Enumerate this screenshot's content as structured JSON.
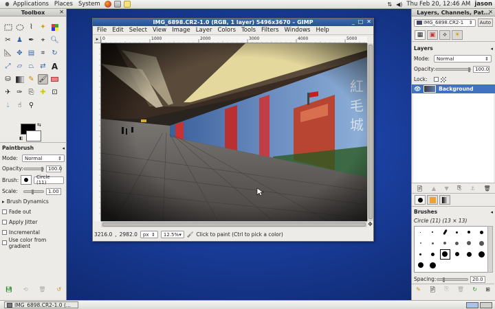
{
  "topbar": {
    "applications": "Applications",
    "places": "Places",
    "system": "System",
    "datetime": "Thu Feb 20, 12:46 AM",
    "user": "jason"
  },
  "toolbox": {
    "title": "Toolbox",
    "tool_options": {
      "title": "Paintbrush",
      "mode_label": "Mode:",
      "mode_value": "Normal",
      "opacity_label": "Opacity:",
      "opacity_value": "100.0",
      "brush_label": "Brush:",
      "brush_value": "Circle (11)",
      "scale_label": "Scale:",
      "scale_value": "1.00",
      "brush_dynamics": "Brush Dynamics",
      "fade_out": "Fade out",
      "apply_jitter": "Apply Jitter",
      "incremental": "Incremental",
      "use_color_gradient": "Use color from gradient"
    }
  },
  "image_window": {
    "title": "IMG_6898.CR2-1.0 (RGB, 1 layer) 5496x3670 – GIMP",
    "menus": [
      "File",
      "Edit",
      "Select",
      "View",
      "Image",
      "Layer",
      "Colors",
      "Tools",
      "Filters",
      "Windows",
      "Help"
    ],
    "ruler_ticks": [
      "0",
      "1000",
      "2000",
      "3000",
      "4000",
      "5000"
    ],
    "status": {
      "x": "3216.0",
      "y": "2982.0",
      "unit": "px",
      "zoom": "12.5%",
      "message": "Click to paint (Ctrl to pick a color)"
    }
  },
  "dock": {
    "title": "Layers, Channels, Pat...",
    "image_combo": "IMG_6898.CR2-1",
    "auto_button": "Auto",
    "layers_title": "Layers",
    "mode_label": "Mode:",
    "mode_value": "Normal",
    "opacity_label": "Opacity:",
    "opacity_value": "100.0",
    "lock_label": "Lock:",
    "layer_name": "Background",
    "brushes_title": "Brushes",
    "brush_info": "Circle (11) (13 × 13)",
    "spacing_label": "Spacing:",
    "spacing_value": "20.0"
  },
  "taskbar": {
    "task": "IMG_6898.CR2-1.0 (..."
  },
  "photo": {
    "sign_chars": "紅毛城"
  },
  "colors": {
    "accent": "#3f72c0",
    "window_title": "#2b5798",
    "foreground": "#000000",
    "background": "#ffffff"
  }
}
